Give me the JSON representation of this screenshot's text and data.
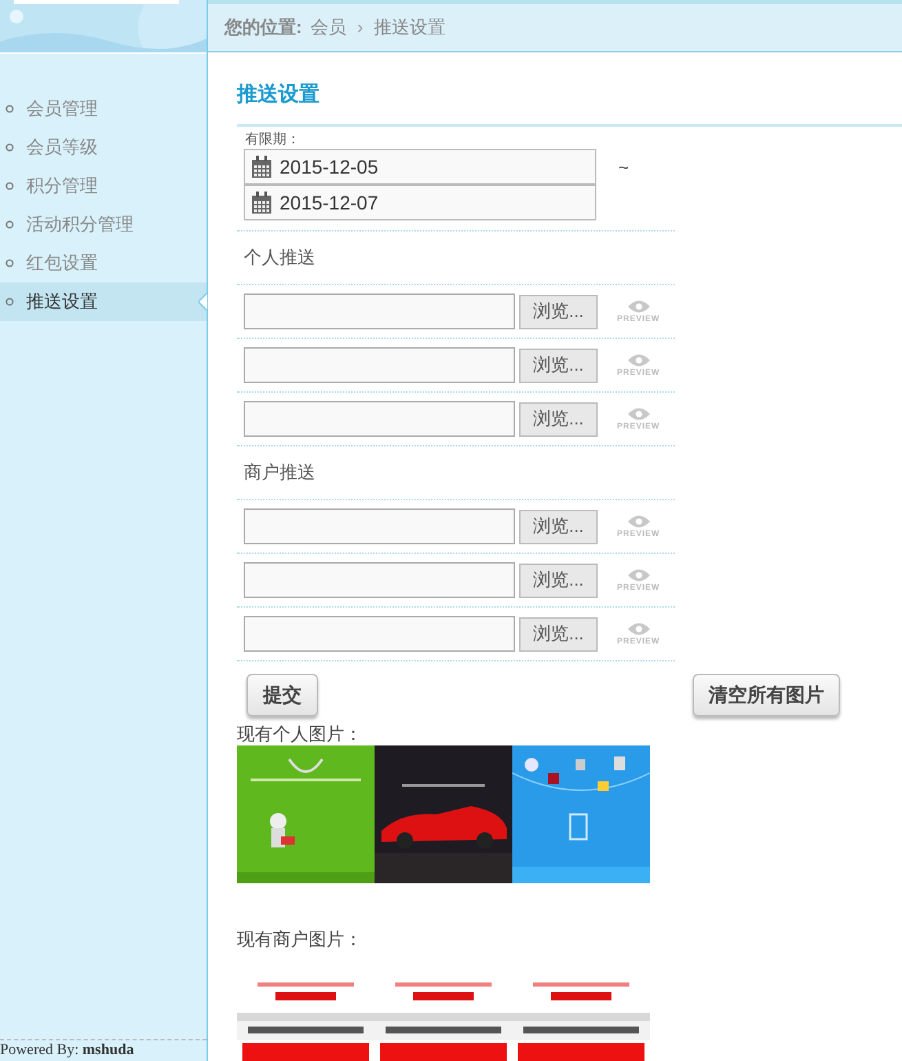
{
  "breadcrumb": {
    "label": "您的位置:",
    "items": [
      "会员",
      "推送设置"
    ],
    "separator": "›"
  },
  "sidebar": {
    "items": [
      {
        "label": "会员管理",
        "selected": false
      },
      {
        "label": "会员等级",
        "selected": false
      },
      {
        "label": "积分管理",
        "selected": false
      },
      {
        "label": "活动积分管理",
        "selected": false
      },
      {
        "label": "红包设置",
        "selected": false
      },
      {
        "label": "推送设置",
        "selected": true
      }
    ]
  },
  "powered_by": {
    "label": "Powered By:",
    "name": "mshuda"
  },
  "page_title": "推送设置",
  "validity": {
    "label": "有限期：",
    "start": "2015-12-05",
    "end": "2015-12-07",
    "separator": "~"
  },
  "sections": [
    {
      "title": "个人推送",
      "uploads": [
        {
          "button": "浏览...",
          "preview": "PREVIEW"
        },
        {
          "button": "浏览...",
          "preview": "PREVIEW"
        },
        {
          "button": "浏览...",
          "preview": "PREVIEW"
        }
      ]
    },
    {
      "title": "商户推送",
      "uploads": [
        {
          "button": "浏览...",
          "preview": "PREVIEW"
        },
        {
          "button": "浏览...",
          "preview": "PREVIEW"
        },
        {
          "button": "浏览...",
          "preview": "PREVIEW"
        }
      ]
    }
  ],
  "actions": [
    {
      "label": "提交",
      "kind": "submit"
    },
    {
      "label": "清空所有图片",
      "kind": "clear"
    }
  ],
  "galleries": [
    {
      "title": "现有个人图片："
    },
    {
      "title": "现有商户图片："
    }
  ]
}
